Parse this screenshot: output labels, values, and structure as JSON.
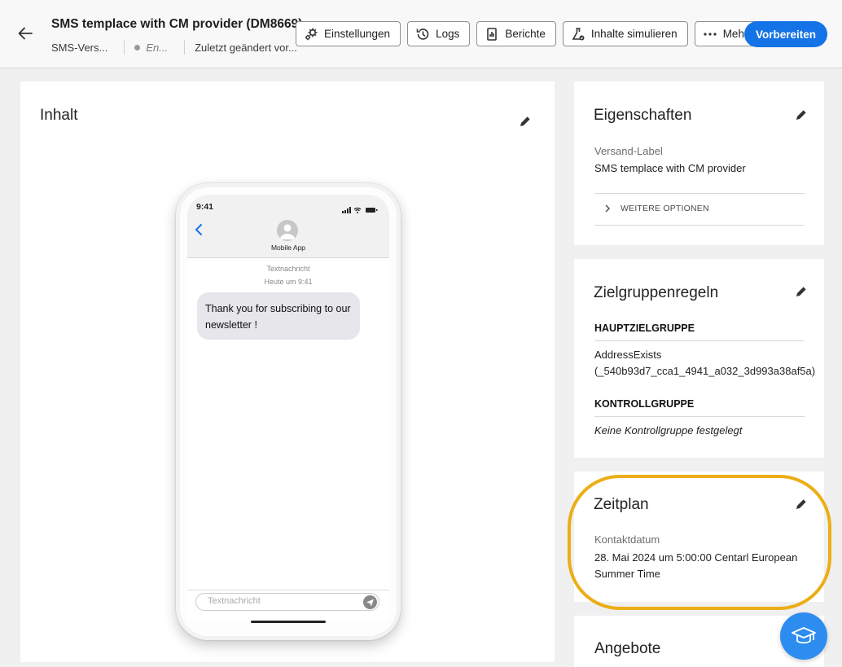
{
  "header": {
    "title": "SMS templace with CM provider (DM8669)",
    "channel": "SMS-Vers...",
    "status": "En...",
    "modified": "Zuletzt geändert vor...",
    "toolbar": [
      {
        "label": "Einstellungen",
        "icon": "settings-icon"
      },
      {
        "label": "Logs",
        "icon": "history-icon"
      },
      {
        "label": "Berichte",
        "icon": "report-icon"
      },
      {
        "label": "Inhalte simulieren",
        "icon": "beaker-icon"
      },
      {
        "label": "Mehr",
        "icon": "more-icon"
      }
    ],
    "primary": "Vorbereiten"
  },
  "content": {
    "title": "Inhalt",
    "phone": {
      "time": "9:41",
      "contact": "Mobile App",
      "sms_label": "Textnachricht",
      "sms_time": "Heute um 9:41",
      "message": "Thank you for subscribing to our newsletter !",
      "input_placeholder": "Textnachricht"
    }
  },
  "properties": {
    "title": "Eigenschaften",
    "label_name": "Versand-Label",
    "label_value": "SMS templace with CM provider",
    "more_options": "WEITERE OPTIONEN"
  },
  "audience": {
    "title": "Zielgruppenregeln",
    "main_heading": "HAUPTZIELGRUPPE",
    "main_line1": "AddressExists",
    "main_line2": "(_540b93d7_cca1_4941_a032_3d993a38af5a)",
    "control_heading": "KONTROLLGRUPPE",
    "control_value": "Keine Kontrollgruppe festgelegt"
  },
  "schedule": {
    "title": "Zeitplan",
    "label": "Kontaktdatum",
    "line1": "28. Mai 2024 um 5:00:00 Centarl European",
    "line2": "Summer Time"
  },
  "offers": {
    "title": "Angebote"
  },
  "colors": {
    "accent": "#1473e6",
    "highlight": "#ecae16"
  }
}
